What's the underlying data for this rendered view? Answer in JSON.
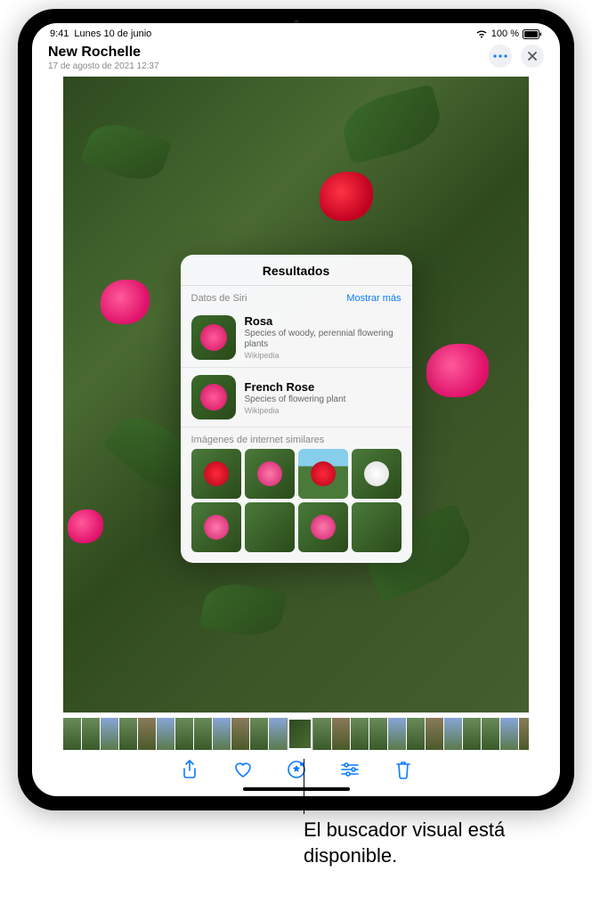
{
  "status": {
    "time": "9:41",
    "date": "Lunes 10 de junio",
    "battery_text": "100 %"
  },
  "header": {
    "title": "New Rochelle",
    "subtitle": "17 de agosto de 2021  12:37"
  },
  "popover": {
    "title": "Resultados",
    "siri_label": "Datos de Siri",
    "more_label": "Mostrar más",
    "results": [
      {
        "title": "Rosa",
        "desc": "Species of woody, perennial flowering plants",
        "source": "Wikipedia"
      },
      {
        "title": "French Rose",
        "desc": "Species of flowering plant",
        "source": "Wikipedia"
      }
    ],
    "similar_label": "Imágenes de internet similares"
  },
  "callout": {
    "text": "El buscador visual está disponible."
  }
}
